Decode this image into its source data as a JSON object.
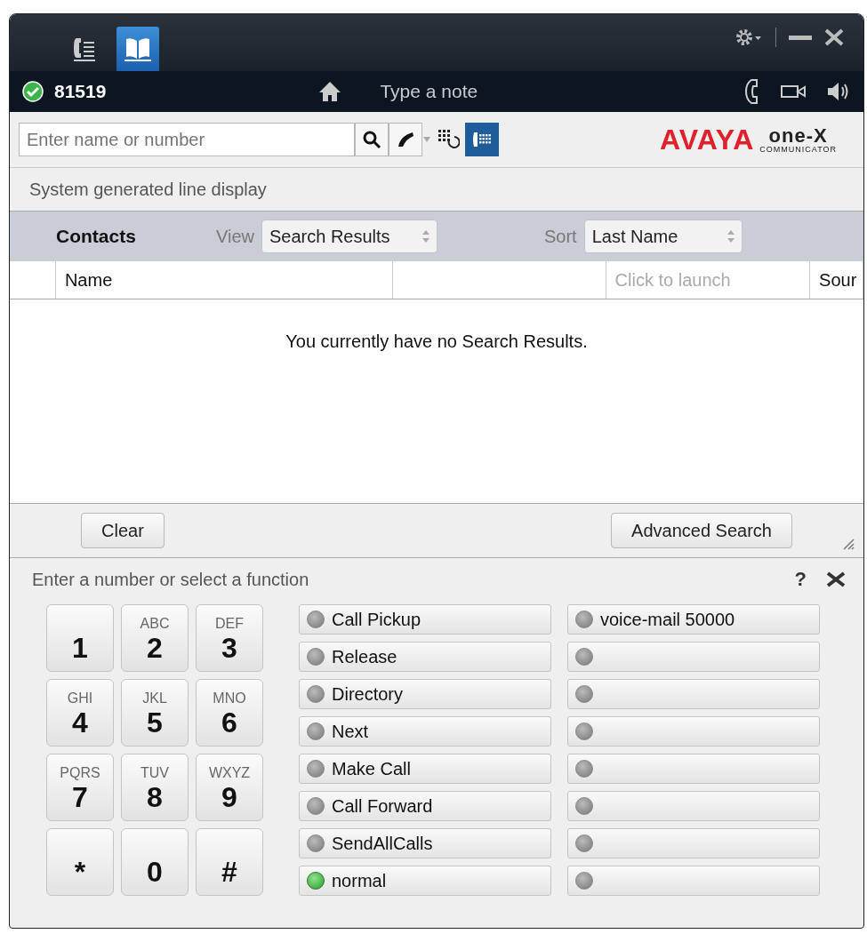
{
  "title_bar": {
    "tabs": [
      {
        "kind": "calls",
        "selected": false
      },
      {
        "kind": "contacts",
        "selected": true
      }
    ]
  },
  "status_bar": {
    "available": true,
    "extension": "81519",
    "note_placeholder": "Type a note"
  },
  "search": {
    "placeholder": "Enter name or number",
    "modes": [
      {
        "kind": "history",
        "selected": false
      },
      {
        "kind": "dialpad",
        "selected": true
      }
    ]
  },
  "logo": {
    "brand": "AVAYA",
    "product": "one-X",
    "subtitle": "COMMUNICATOR"
  },
  "line_display": "System generated line display",
  "contacts": {
    "title": "Contacts",
    "view_label": "View",
    "view": "Search Results",
    "sort_label": "Sort",
    "sort": "Last Name",
    "columns": [
      {
        "kind": "label",
        "label": "Name"
      },
      {
        "kind": "empty"
      },
      {
        "kind": "hint",
        "label": "Click to launch"
      },
      {
        "kind": "label",
        "label": "Sour"
      }
    ],
    "empty_message": "You currently have no Search Results.",
    "buttons": [
      "Clear",
      "Advanced Search"
    ]
  },
  "dialpad": {
    "prompt": "Enter a number or select a function",
    "help": "?",
    "key_rows": [
      [
        {
          "digit": "1"
        },
        {
          "digit": "2",
          "letters": "ABC"
        },
        {
          "digit": "3",
          "letters": "DEF"
        }
      ],
      [
        {
          "digit": "4",
          "letters": "GHI"
        },
        {
          "digit": "5",
          "letters": "JKL"
        },
        {
          "digit": "6",
          "letters": "MNO"
        }
      ],
      [
        {
          "digit": "7",
          "letters": "PQRS"
        },
        {
          "digit": "8",
          "letters": "TUV"
        },
        {
          "digit": "9",
          "letters": "WXYZ"
        }
      ],
      [
        {
          "digit": "*"
        },
        {
          "digit": "0"
        },
        {
          "digit": "#"
        }
      ]
    ],
    "features": [
      [
        {
          "label": "Call Pickup",
          "on": false
        },
        {
          "label": "Release",
          "on": false
        },
        {
          "label": "Directory",
          "on": false
        },
        {
          "label": "Next",
          "on": false
        },
        {
          "label": "Make Call",
          "on": false
        },
        {
          "label": "Call Forward",
          "on": false
        },
        {
          "label": "SendAllCalls",
          "on": false
        },
        {
          "label": "normal",
          "on": true
        }
      ],
      [
        {
          "label": "voice-mail 50000",
          "on": false
        },
        {
          "on": false
        },
        {
          "on": false
        },
        {
          "on": false
        },
        {
          "on": false
        },
        {
          "on": false
        },
        {
          "on": false
        },
        {
          "on": false
        }
      ]
    ]
  }
}
